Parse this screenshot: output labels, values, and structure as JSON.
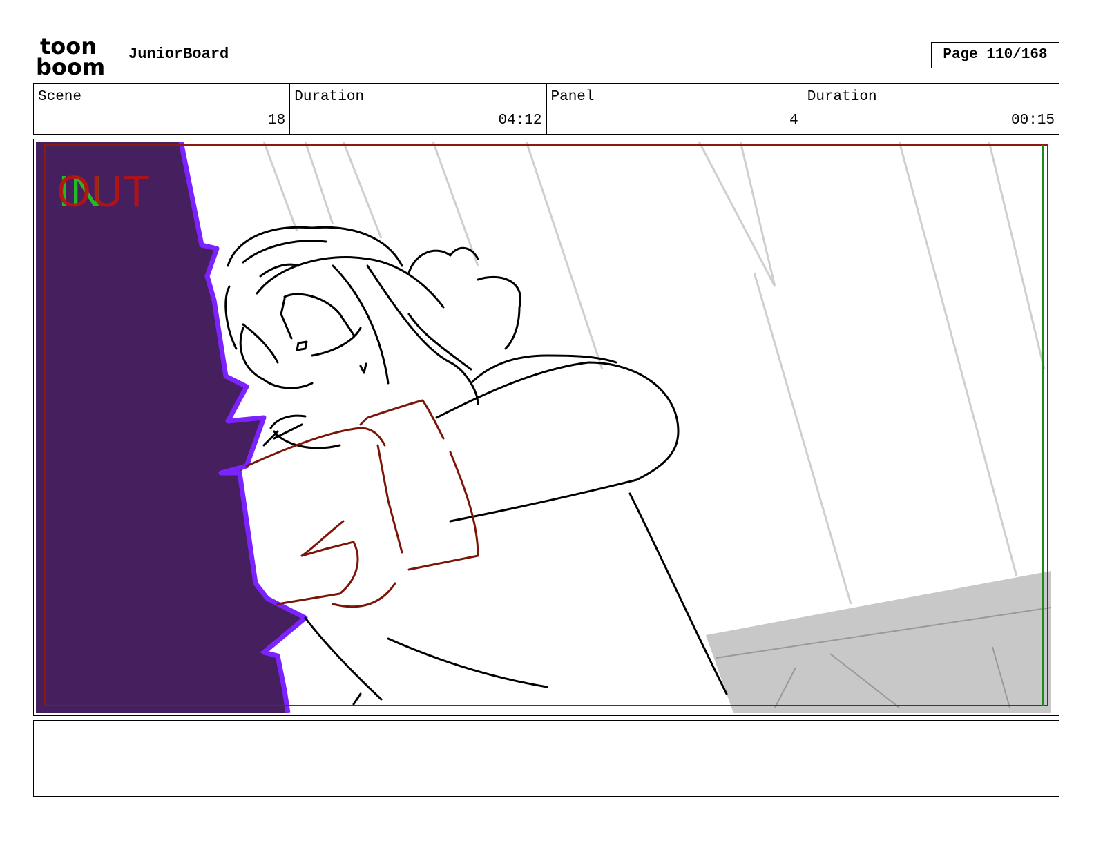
{
  "header": {
    "logo_text_top": "toon",
    "logo_text_bottom": "boom",
    "app_title": "JuniorBoard",
    "page_label": "Page 110/168"
  },
  "info": {
    "scene_label": "Scene",
    "scene_value": "18",
    "scene_duration_label": "Duration",
    "scene_duration_value": "04:12",
    "panel_label": "Panel",
    "panel_value": "4",
    "panel_duration_label": "Duration",
    "panel_duration_value": "00:15"
  },
  "panel": {
    "in_label": "IN",
    "out_label": "OUT",
    "colors": {
      "wall": "#46205e",
      "wall_edge": "#7b22ff",
      "frame_red": "#8b1a10",
      "frame_green": "#1f8a1f",
      "in_green": "#22bb22",
      "out_red": "#bb1111",
      "floor_gray": "#c8c8c8",
      "sketch_line": "#000000",
      "scarf": "#7a1508"
    }
  },
  "notes": {
    "text": ""
  }
}
